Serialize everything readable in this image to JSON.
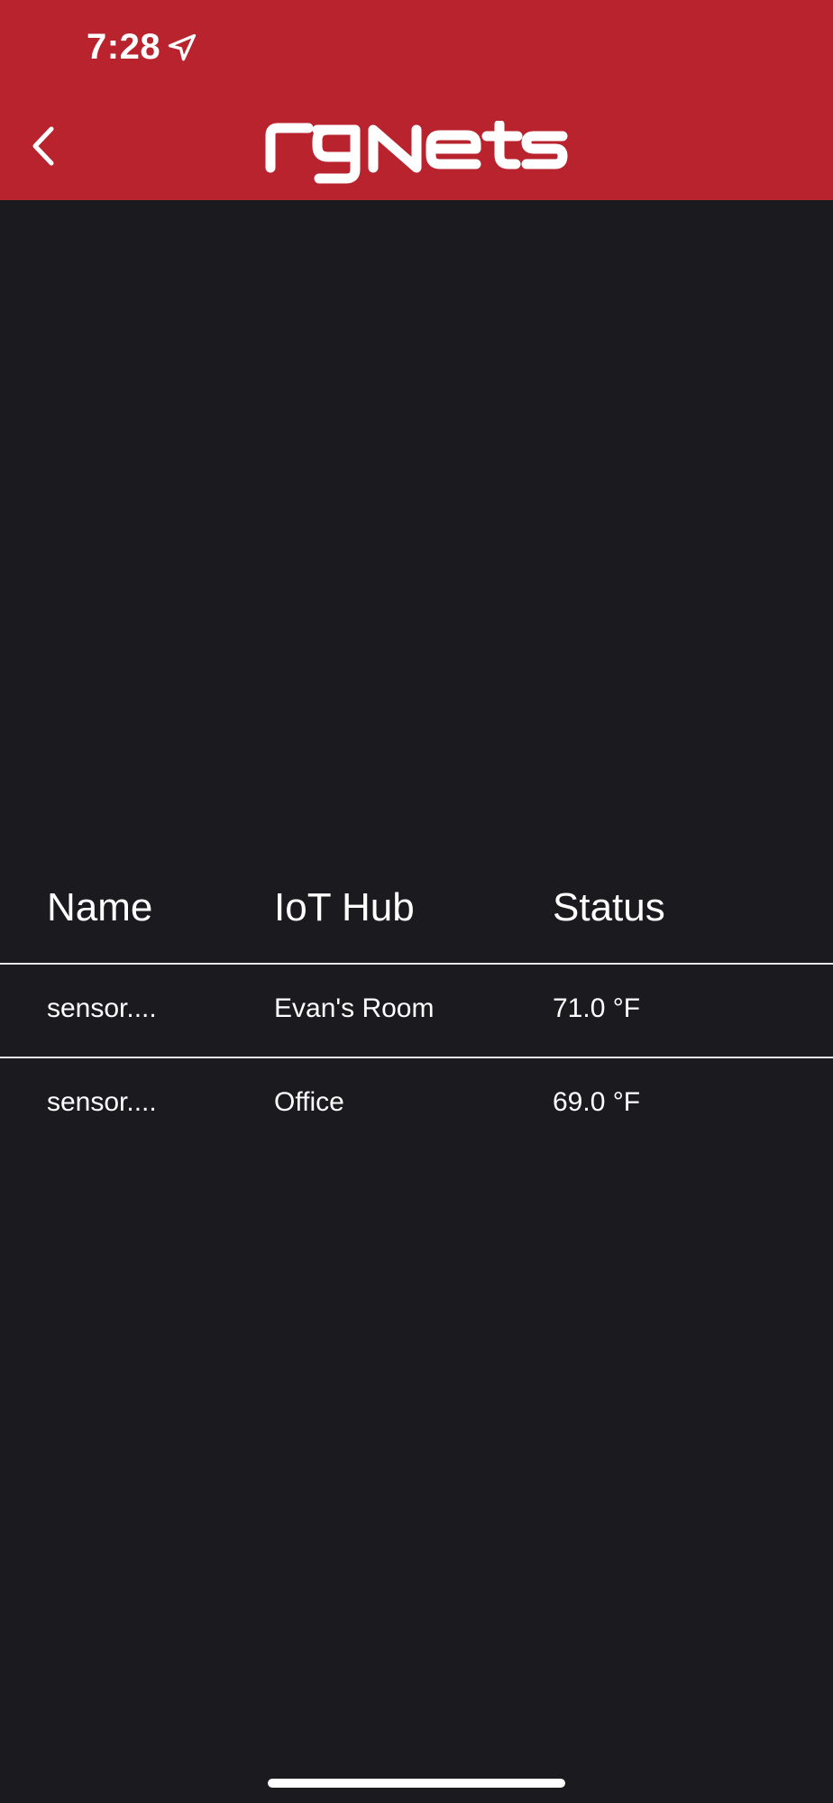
{
  "status_bar": {
    "time": "7:28",
    "location_icon": "location-arrow-icon"
  },
  "header": {
    "back_icon": "chevron-left-icon",
    "brand": "rgNets",
    "background_color": "#b8232d"
  },
  "table": {
    "headers": {
      "name": "Name",
      "hub": "IoT Hub",
      "status": "Status"
    },
    "rows": [
      {
        "name": "sensor....",
        "hub": "Evan's Room",
        "status": "71.0 °F"
      },
      {
        "name": "sensor....",
        "hub": "Office",
        "status": "69.0 °F"
      }
    ]
  },
  "colors": {
    "background": "#1b1a1f",
    "text": "#ffffff",
    "accent": "#b8232d"
  }
}
